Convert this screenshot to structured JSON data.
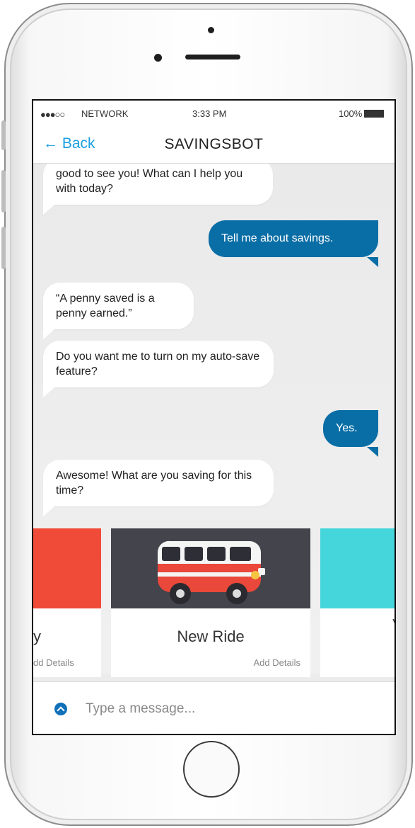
{
  "status_bar": {
    "signal": "●●●○○",
    "network": "NETWORK",
    "time": "3:33 PM",
    "battery": "100%"
  },
  "nav": {
    "back_label": "← Back",
    "title": "SAVINGSBOT"
  },
  "messages": [
    {
      "sender": "bot",
      "text": "good to see you!  What can I help you with today?"
    },
    {
      "sender": "user",
      "text": "Tell me about savings."
    },
    {
      "sender": "bot",
      "text": "“A penny saved is a penny earned.”"
    },
    {
      "sender": "bot",
      "text": "Do you want me to turn on my auto-save feature?"
    },
    {
      "sender": "user",
      "text": "Yes."
    },
    {
      "sender": "bot",
      "text": "Awesome!  What are you saving for this time?"
    }
  ],
  "cards": [
    {
      "name": "y",
      "details": "dd Details",
      "color": "#f04a38"
    },
    {
      "name": "New Ride",
      "details": "Add Details",
      "color": "#44444c"
    },
    {
      "name": "V",
      "details": "",
      "color": "#45d6dc"
    }
  ],
  "composer": {
    "placeholder": "Type a message..."
  }
}
